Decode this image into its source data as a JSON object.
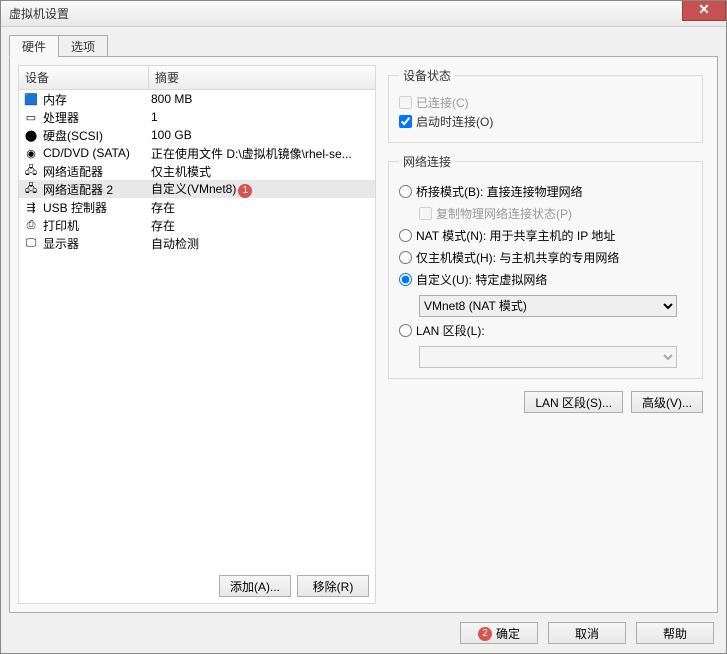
{
  "window": {
    "title": "虚拟机设置"
  },
  "tabs": {
    "hw": "硬件",
    "opt": "选项"
  },
  "columns": {
    "device": "设备",
    "summary": "摘要"
  },
  "devices": [
    {
      "name": "内存",
      "summary": "800 MB",
      "icon": "🟦"
    },
    {
      "name": "处理器",
      "summary": "1",
      "icon": "▭"
    },
    {
      "name": "硬盘(SCSI)",
      "summary": "100 GB",
      "icon": "⬤"
    },
    {
      "name": "CD/DVD (SATA)",
      "summary": "正在使用文件 D:\\虚拟机镜像\\rhel-se...",
      "icon": "◉"
    },
    {
      "name": "网络适配器",
      "summary": "仅主机模式",
      "icon": "🖧"
    },
    {
      "name": "网络适配器 2",
      "summary": "自定义(VMnet8)",
      "icon": "🖧",
      "selected": true,
      "badge": "1"
    },
    {
      "name": "USB 控制器",
      "summary": "存在",
      "icon": "⇶"
    },
    {
      "name": "打印机",
      "summary": "存在",
      "icon": "⎙"
    },
    {
      "name": "显示器",
      "summary": "自动检测",
      "icon": "🖵"
    }
  ],
  "leftButtons": {
    "add": "添加(A)...",
    "remove": "移除(R)"
  },
  "status": {
    "legend": "设备状态",
    "connected": "已连接(C)",
    "connectAtPowerOn": "启动时连接(O)"
  },
  "net": {
    "legend": "网络连接",
    "bridged": "桥接模式(B): 直接连接物理网络",
    "replicate": "复制物理网络连接状态(P)",
    "nat": "NAT 模式(N): 用于共享主机的 IP 地址",
    "hostonly": "仅主机模式(H): 与主机共享的专用网络",
    "custom": "自定义(U): 特定虚拟网络",
    "customValue": "VMnet8 (NAT 模式)",
    "lan": "LAN 区段(L):",
    "lanValue": ""
  },
  "rightButtons": {
    "lanseg": "LAN 区段(S)...",
    "advanced": "高级(V)..."
  },
  "footer": {
    "ok": "确定",
    "cancel": "取消",
    "help": "帮助",
    "badge": "2"
  }
}
